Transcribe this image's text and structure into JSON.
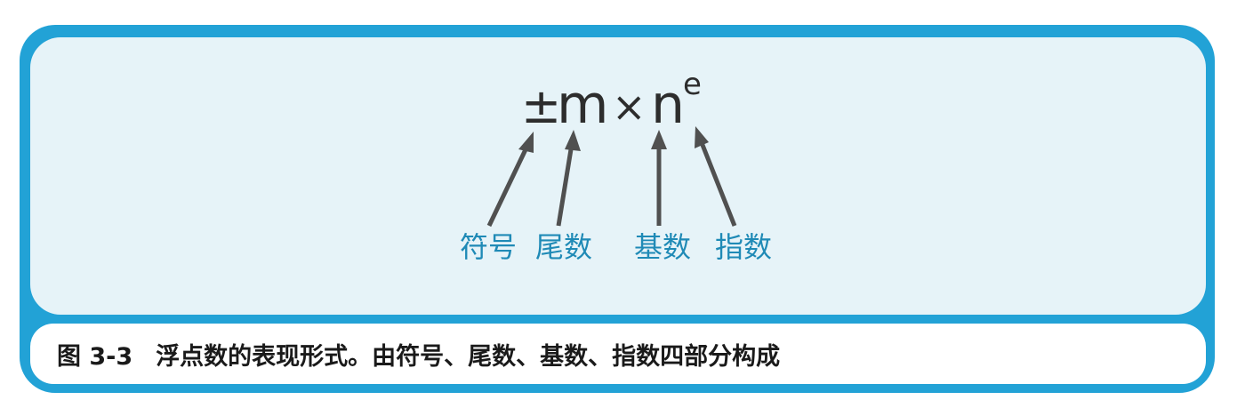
{
  "formula": {
    "sign": "±",
    "mantissa": "m",
    "times": "×",
    "base": "n",
    "exponent": "e"
  },
  "labels": {
    "sign": "符号",
    "mantissa": "尾数",
    "base": "基数",
    "exponent": "指数"
  },
  "caption": {
    "number": "图 3-3",
    "text": "浮点数的表现形式。由符号、尾数、基数、指数四部分构成"
  },
  "colors": {
    "frame": "#22a2d6",
    "panel": "#e6f3f8",
    "label": "#1f8ab6",
    "arrow": "#505050"
  }
}
